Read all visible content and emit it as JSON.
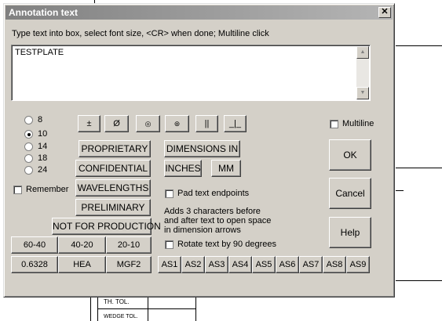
{
  "dialog": {
    "title": "Annotation text",
    "close_symbol": "✕",
    "instructions": "Type text into box, select font size, <CR> when done; Multiline click",
    "text_value": "TESTPLATE",
    "font_sizes": [
      {
        "label": "8",
        "selected": false
      },
      {
        "label": "10",
        "selected": true
      },
      {
        "label": "14",
        "selected": false
      },
      {
        "label": "18",
        "selected": false
      },
      {
        "label": "24",
        "selected": false
      }
    ],
    "remember_label": "Remember",
    "symbols": {
      "plus_minus": "±",
      "diameter": "Ø",
      "circle_dot": "◎",
      "circle_plus": "⊛",
      "parallel": "||",
      "perpendicular": "_|_"
    },
    "presets": {
      "proprietary": "PROPRIETARY",
      "confidential": "CONFIDENTIAL",
      "wavelengths": "WAVELENGTHS",
      "preliminary": "PRELIMINARY",
      "not_for_production": "NOT FOR PRODUCTION",
      "r1": [
        "60-40",
        "40-20",
        "20-10"
      ],
      "r2": [
        "0.6328",
        "HEA",
        "MGF2"
      ]
    },
    "dimensions": {
      "label": "DIMENSIONS IN",
      "inches": "INCHES",
      "mm": "MM"
    },
    "pad_label": "Pad text endpoints",
    "pad_info": "Adds 3 characters before\nand after text to open space\nin dimension arrows",
    "rotate_label": "Rotate text by 90 degrees",
    "as_buttons": [
      "AS1",
      "AS2",
      "AS3",
      "AS4",
      "AS5",
      "AS6",
      "AS7",
      "AS8",
      "AS9"
    ],
    "multiline_label": "Multiline",
    "ok_label": "OK",
    "cancel_label": "Cancel",
    "help_label": "Help"
  },
  "background": {
    "th_tol": "TH. TOL.",
    "wedge_tol": "WEDGE TOL."
  }
}
